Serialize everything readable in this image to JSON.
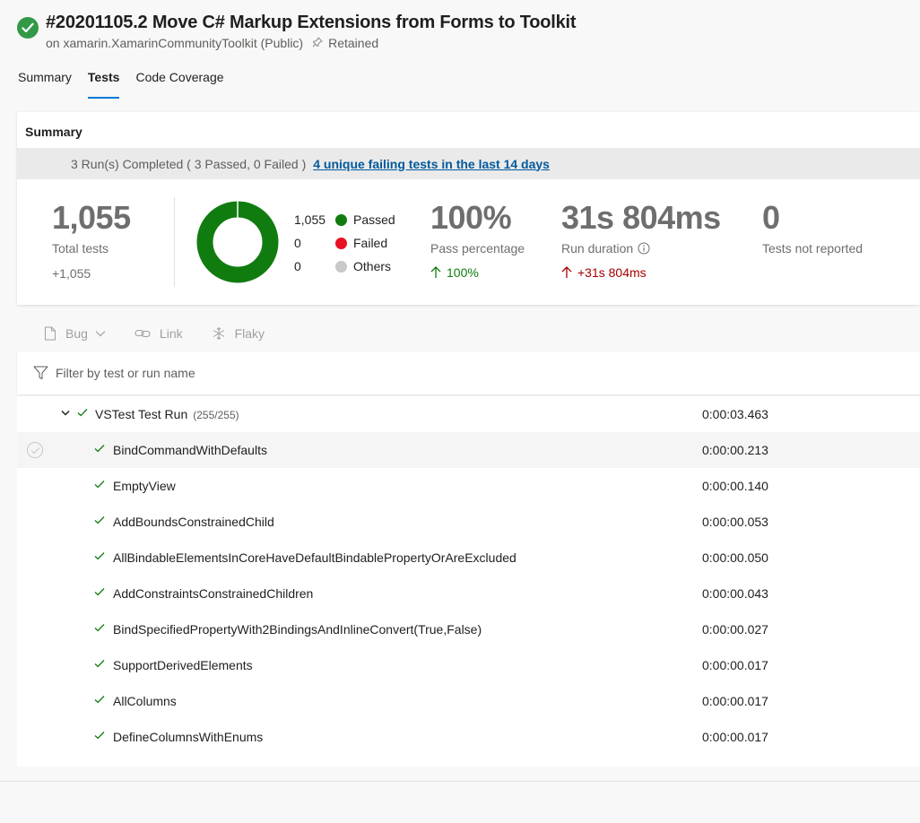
{
  "header": {
    "title": "#20201105.2 Move C# Markup Extensions from Forms to Toolkit",
    "repo": "on xamarin.XamarinCommunityToolkit (Public)",
    "retained": "Retained"
  },
  "tabs": [
    {
      "label": "Summary"
    },
    {
      "label": "Tests"
    },
    {
      "label": "Code Coverage"
    }
  ],
  "summary": {
    "title": "Summary",
    "runs_completed": "3 Run(s) Completed ( 3 Passed, 0 Failed )",
    "failing_link": "4 unique failing tests in the last 14 days",
    "total_tests": "1,055",
    "total_label": "Total tests",
    "total_delta": "+1,055",
    "legend": [
      {
        "count": "1,055",
        "label": "Passed",
        "color": "#107c10"
      },
      {
        "count": "0",
        "label": "Failed",
        "color": "#e81123"
      },
      {
        "count": "0",
        "label": "Others",
        "color": "#c8c8c8"
      }
    ],
    "pass_pct": "100%",
    "pass_label": "Pass percentage",
    "pass_delta": "100%",
    "duration": "31s 804ms",
    "duration_label": "Run duration",
    "duration_delta": "+31s 804ms",
    "not_reported": "0",
    "not_reported_label": "Tests not reported"
  },
  "toolbar": {
    "bug": "Bug",
    "link": "Link",
    "flaky": "Flaky"
  },
  "filter": {
    "placeholder": "Filter by test or run name"
  },
  "results": {
    "run": {
      "name": "VSTest Test Run",
      "count": "(255/255)",
      "duration": "0:00:03.463"
    },
    "tests": [
      {
        "name": "BindCommandWithDefaults",
        "duration": "0:00:00.213"
      },
      {
        "name": "EmptyView",
        "duration": "0:00:00.140"
      },
      {
        "name": "AddBoundsConstrainedChild",
        "duration": "0:00:00.053"
      },
      {
        "name": "AllBindableElementsInCoreHaveDefaultBindablePropertyOrAreExcluded",
        "duration": "0:00:00.050"
      },
      {
        "name": "AddConstraintsConstrainedChildren",
        "duration": "0:00:00.043"
      },
      {
        "name": "BindSpecifiedPropertyWith2BindingsAndInlineConvert(True,False)",
        "duration": "0:00:00.027"
      },
      {
        "name": "SupportDerivedElements",
        "duration": "0:00:00.017"
      },
      {
        "name": "AllColumns",
        "duration": "0:00:00.017"
      },
      {
        "name": "DefineColumnsWithEnums",
        "duration": "0:00:00.017"
      }
    ]
  },
  "colors": {
    "success": "#339947",
    "passed": "#107c10",
    "failed_red": "#a80000",
    "accent": "#0078d4",
    "link": "#005a9e"
  }
}
